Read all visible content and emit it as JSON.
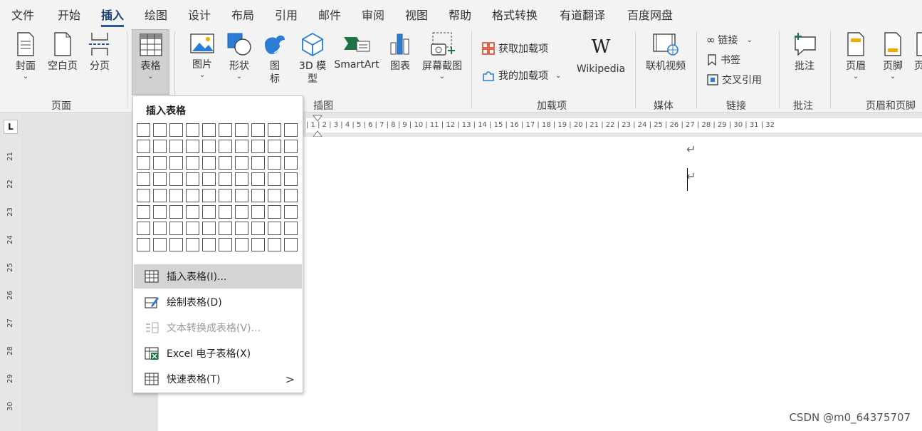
{
  "menu_tabs": [
    "文件",
    "开始",
    "插入",
    "绘图",
    "设计",
    "布局",
    "引用",
    "邮件",
    "审阅",
    "视图",
    "帮助",
    "格式转换",
    "有道翻译",
    "百度网盘"
  ],
  "active_tab": "插入",
  "ribbon": {
    "page_group": {
      "label": "页面",
      "buttons": [
        "封面",
        "空白页",
        "分页"
      ]
    },
    "table_button": "表格",
    "illustrations_group": {
      "label": "插图",
      "buttons": [
        "图片",
        "形状",
        "图",
        "标",
        "3D 模",
        "型",
        "SmartArt",
        "图表",
        "屏幕截图"
      ]
    },
    "addins_group": {
      "label": "加载项",
      "get_addins": "获取加载项",
      "my_addins": "我的加载项",
      "wikipedia": "Wikipedia",
      "wiki_letter": "W"
    },
    "media_group": {
      "label": "媒体",
      "online_video": "联机视频"
    },
    "links_group": {
      "label": "链接",
      "link": "链接",
      "bookmark": "书签",
      "cross_ref": "交叉引用"
    },
    "comments_group": {
      "label": "批注",
      "comment": "批注"
    },
    "header_footer_group": {
      "label": "页眉和页脚",
      "header": "页眉",
      "footer": "页脚",
      "page_partial": "页"
    }
  },
  "dropdown": {
    "title": "插入表格",
    "items": [
      {
        "label": "插入表格(I)...",
        "state": "hover"
      },
      {
        "label": "绘制表格(D)",
        "state": "normal"
      },
      {
        "label": "文本转换成表格(V)...",
        "state": "disabled"
      },
      {
        "label": "Excel 电子表格(X)",
        "state": "normal"
      },
      {
        "label": "快速表格(T)",
        "state": "normal",
        "submenu": ">"
      }
    ]
  },
  "ruler": {
    "corner_glyph": "L",
    "horizontal_text": "| 1 | 2 | 3 | 4 | 5 | 6 | 7 | 8 | 9 | 10 | 11 | 12 | 13 | 14 | 15 | 16 | 17 | 18 | 19 | 20 | 21 | 22 | 23 | 24 | 25 | 26 | 27 | 28 | 29 | 30 | 31 | 32",
    "vertical_numbers": [
      "21",
      "22",
      "23",
      "24",
      "25",
      "26",
      "27",
      "28",
      "29",
      "30"
    ]
  },
  "document": {
    "paragraph_mark": "↵"
  },
  "watermark": "CSDN @m0_64375707",
  "colors": {
    "accent": "#2b579a",
    "hover": "#d4d4d4",
    "excel_green": "#1f7244"
  }
}
